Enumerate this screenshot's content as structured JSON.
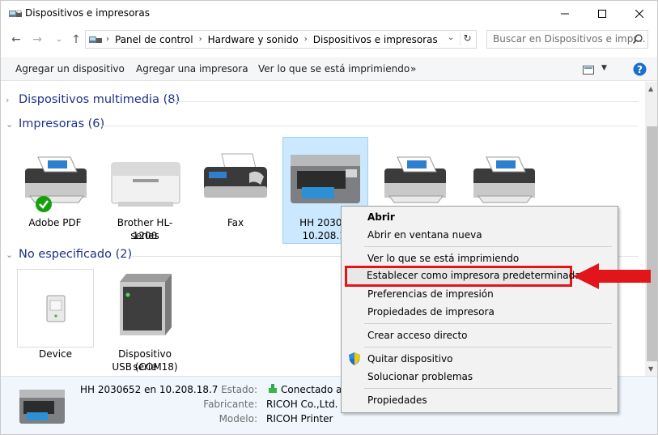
{
  "window": {
    "title": "Dispositivos e impresoras"
  },
  "address": {
    "crumbs": [
      "Panel de control",
      "Hardware y sonido",
      "Dispositivos e impresoras"
    ]
  },
  "search": {
    "placeholder": "Buscar en Dispositivos e impr..."
  },
  "commands": {
    "add_device": "Agregar un dispositivo",
    "add_printer": "Agregar una impresora",
    "see_printing": "Ver lo que se está imprimiendo",
    "more": "»"
  },
  "groups": {
    "multimedia": "Dispositivos multimedia (8)",
    "printers": "Impresoras (6)",
    "unspecified": "No especificado (2)"
  },
  "printers": [
    {
      "label": "Adobe PDF"
    },
    {
      "label1": "Brother HL-1200",
      "label2": "series"
    },
    {
      "label": "Fax"
    },
    {
      "label1": "HH 203065",
      "label2": "10.208.18"
    }
  ],
  "unspecified": [
    {
      "label": "Device"
    },
    {
      "label1": "Dispositivo serie",
      "label2": "USB (COM18)"
    }
  ],
  "context_menu": {
    "open": "Abrir",
    "open_new": "Abrir en ventana nueva",
    "see_printing": "Ver lo que se está imprimiendo",
    "set_default": "Establecer como impresora predeterminada",
    "preferences": "Preferencias de impresión",
    "properties_printer": "Propiedades de impresora",
    "shortcut": "Crear acceso directo",
    "remove": "Quitar dispositivo",
    "troubleshoot": "Solucionar problemas",
    "properties": "Propiedades"
  },
  "details": {
    "name": "HH 2030652  en 10.208.18.7",
    "state_label": "Estado:",
    "state_value": "Conectado a",
    "maker_label": "Fabricante:",
    "maker_value": "RICOH Co.,Ltd.",
    "model_label": "Modelo:",
    "model_value": "RICOH Printer"
  },
  "colors": {
    "accent": "#1e3287",
    "highlight": "#e2151b",
    "selection": "#cce8ff"
  }
}
